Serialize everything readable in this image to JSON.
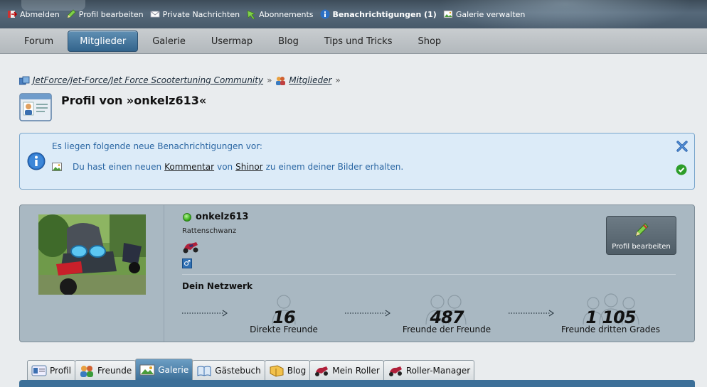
{
  "userbar": {
    "items": [
      {
        "label": "Abmelden",
        "icon": "logout-icon"
      },
      {
        "label": "Profil bearbeiten",
        "icon": "pencil-icon"
      },
      {
        "label": "Private Nachrichten",
        "icon": "mail-icon"
      },
      {
        "label": "Abonnements",
        "icon": "bookmark-icon"
      },
      {
        "label": "Benachrichtigungen (1)",
        "icon": "info-icon"
      },
      {
        "label": "Galerie verwalten",
        "icon": "gallery-icon"
      }
    ]
  },
  "mainnav": {
    "items": [
      "Forum",
      "Mitglieder",
      "Galerie",
      "Usermap",
      "Blog",
      "Tips und Tricks",
      "Shop"
    ],
    "active": "Mitglieder"
  },
  "breadcrumb": {
    "items": [
      "JetForce/Jet-Force/Jet Force Scootertuning Community",
      "Mitglieder"
    ],
    "separator": "»"
  },
  "page": {
    "title": "Profil von »onkelz613«"
  },
  "notification": {
    "heading": "Es liegen folgende neue Benachrichtigungen vor:",
    "text_before": "Du hast einen neuen",
    "link1": "Kommentar",
    "text_mid": "von",
    "link2": "Shinor",
    "text_after": "zu einem deiner Bilder erhalten."
  },
  "profile": {
    "username": "onkelz613",
    "rank": "Rattenschwanz",
    "gender_symbol": "♂",
    "network_title": "Dein Netzwerk",
    "edit_label": "Profil bearbeiten",
    "network": [
      {
        "count": "16",
        "label": "Direkte Freunde"
      },
      {
        "count": "487",
        "label": "Freunde der Freunde"
      },
      {
        "count": "1 105",
        "label": "Freunde dritten Grades"
      }
    ]
  },
  "tabs": {
    "items": [
      {
        "label": "Profil",
        "icon": "profile-card-icon"
      },
      {
        "label": "Freunde",
        "icon": "friends-icon"
      },
      {
        "label": "Galerie",
        "icon": "gallery-icon"
      },
      {
        "label": "Gästebuch",
        "icon": "guestbook-icon"
      },
      {
        "label": "Blog",
        "icon": "blog-icon"
      },
      {
        "label": "Mein Roller",
        "icon": "scooter-icon"
      },
      {
        "label": "Roller-Manager",
        "icon": "scooter-icon"
      }
    ],
    "active": "Galerie"
  }
}
